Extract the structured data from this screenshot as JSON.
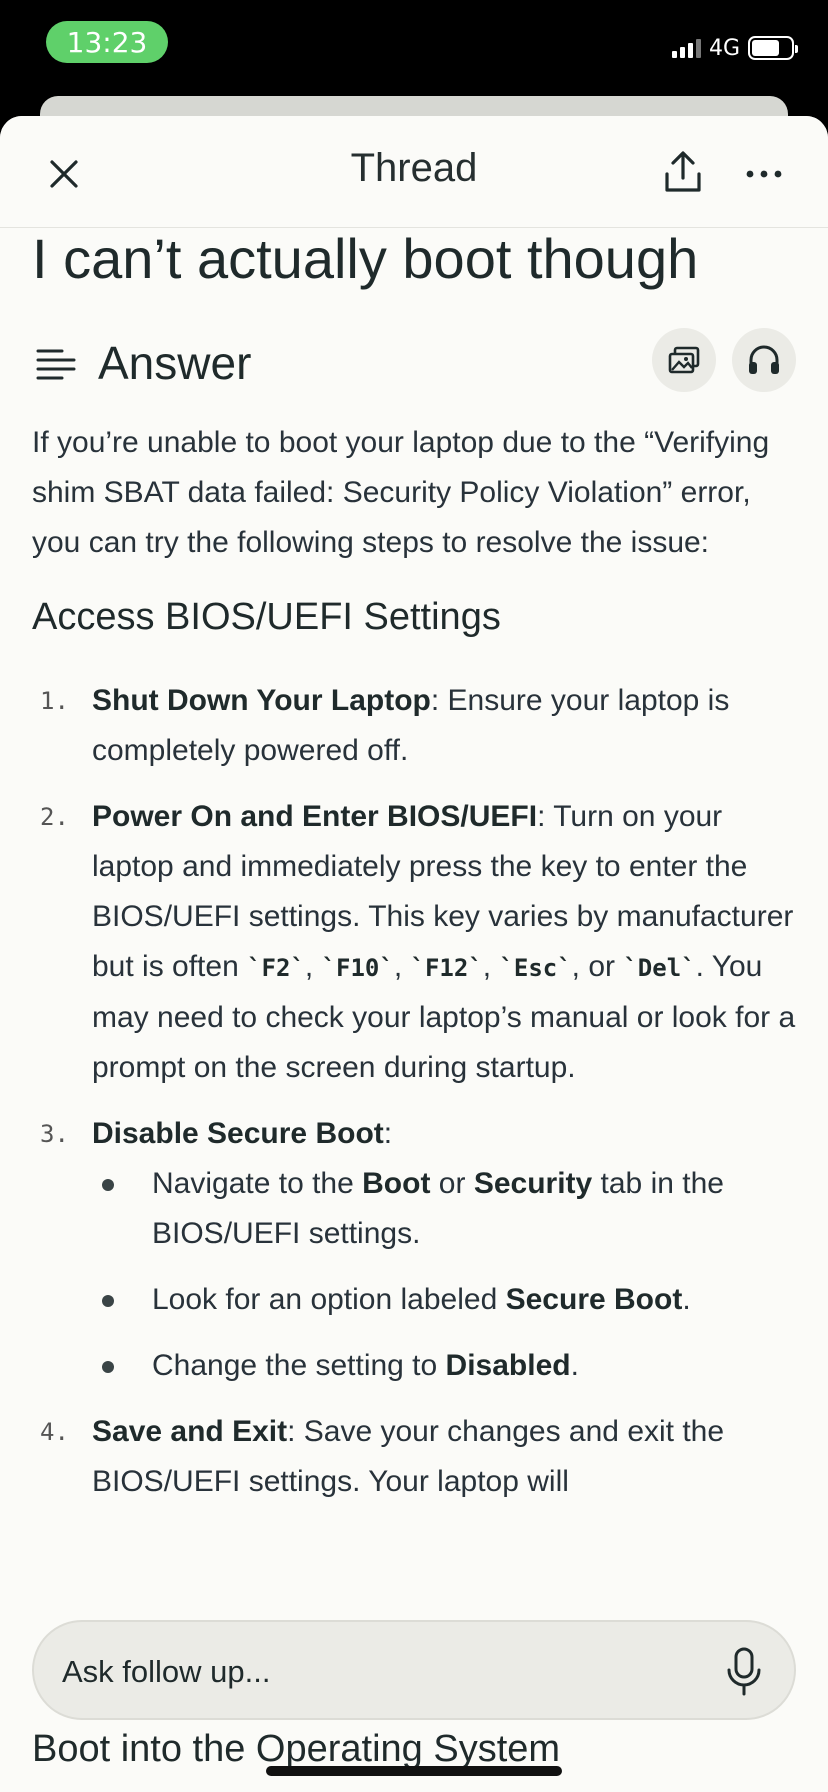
{
  "status_bar": {
    "time": "13:23",
    "network": "4G"
  },
  "nav": {
    "title": "Thread"
  },
  "question": "I can’t actually boot though",
  "answer": {
    "label": "Answer",
    "intro": "If you’re unable to boot your laptop due to the “Verifying shim SBAT data failed: Security Policy Violation” error, you can try the following steps to resolve the issue:",
    "section_title": "Access BIOS/UEFI Settings",
    "steps": [
      {
        "num": "1.",
        "bold": "Shut Down Your Laptop",
        "text": ": Ensure your laptop is completely powered off."
      },
      {
        "num": "2.",
        "bold": "Power On and Enter BIOS/UEFI",
        "text_a": ": Turn on your laptop and immediately press the key to enter the BIOS/UEFI settings. This key varies by manufacturer but is often ",
        "keys": [
          "`F2`",
          "`F10`",
          "`F12`",
          "`Esc`",
          "`Del`"
        ],
        "sep1": ", ",
        "sep_or": ", or ",
        "text_b": ". You may need to check your laptop’s manual or look for a prompt on the screen during startup."
      },
      {
        "num": "3.",
        "bold": "Disable Secure Boot",
        "text": ":",
        "bullets": [
          {
            "pre": "Navigate to the ",
            "b1": "Boot",
            "mid": " or ",
            "b2": "Security",
            "post": " tab in the BIOS/UEFI settings."
          },
          {
            "pre": "Look for an option labeled ",
            "b1": "Secure Boot",
            "post": "."
          },
          {
            "pre": "Change the setting to ",
            "b1": "Disabled",
            "post": "."
          }
        ]
      },
      {
        "num": "4.",
        "bold": "Save and Exit",
        "text": ": Save your changes and exit the BIOS/UEFI settings. Your laptop will"
      }
    ],
    "next_section_title": "Boot into the Operating System"
  },
  "follow_up": {
    "placeholder": "Ask follow up..."
  }
}
